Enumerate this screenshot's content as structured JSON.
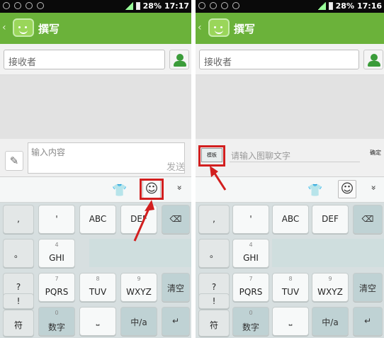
{
  "status": {
    "battery": "28%",
    "time_left": "17:17",
    "time_right": "17:16"
  },
  "header": {
    "back": "‹",
    "title": "撰写"
  },
  "recipient": {
    "placeholder": "接收者"
  },
  "composer": {
    "placeholder": "输入内容",
    "send": "发送",
    "attach_icon": "paperclip-icon"
  },
  "template_bar": {
    "template_label": "模板",
    "input_placeholder": "请输入图聊文字",
    "confirm": "确定"
  },
  "toolbar": {
    "shirt": "👕",
    "smile": "☺",
    "collapse": "»"
  },
  "keys": {
    "comma": ",",
    "apostrophe": "'",
    "period": "。",
    "question": "?",
    "exclaim": "!",
    "abc": "ABC",
    "def": "DEF",
    "ghi": "GHI",
    "pqrs": "PQRS",
    "tuv": "TUV",
    "wxyz": "WXYZ",
    "n4": "4",
    "n7": "7",
    "n8": "8",
    "n9": "9",
    "n0": "0",
    "symbol": "符",
    "number": "数字",
    "chinese": "中/a",
    "clear": "清空",
    "enter": "↵",
    "delete": "⌫",
    "space": "⎵"
  },
  "colors": {
    "header": "#6bb23a",
    "highlight": "#d21f1f"
  }
}
